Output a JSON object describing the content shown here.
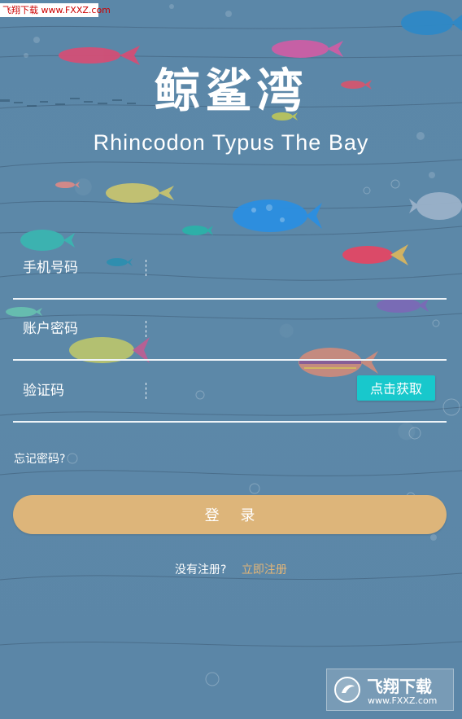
{
  "watermarks": {
    "top": "飞翔下载 www.FXXZ.com",
    "bottom_title": "飞翔下载",
    "bottom_url": "www.FXXZ.com"
  },
  "brand": {
    "title": "鲸鲨湾",
    "subtitle": "Rhincodon Typus The Bay"
  },
  "form": {
    "phone_label": "手机号码",
    "password_label": "账户密码",
    "code_label": "验证码",
    "code_button": "点击获取",
    "forgot_password": "忘记密码?",
    "login_button": "登 录"
  },
  "register": {
    "prompt": "没有注册?",
    "link": "立即注册"
  },
  "colors": {
    "background": "#5a87a8",
    "accent_cyan": "#18c8cc",
    "accent_gold": "#ddb57a"
  },
  "icons": {
    "watermark_logo": "circular-logo-icon"
  }
}
